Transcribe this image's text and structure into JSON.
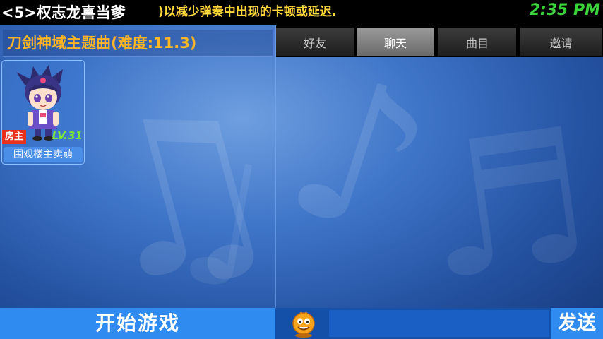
{
  "top_bar": {
    "room_title": "<5>权志龙喜当爹",
    "marquee": ")以减少弹奏中出现的卡顿或延迟.",
    "clock": "2:35 PM"
  },
  "song": {
    "title": "刀剑神域主题曲(难度:11.3)"
  },
  "player": {
    "role_badge": "房主",
    "level": "LV.31",
    "name": "围观楼主卖萌",
    "avatar_icon": "chibi-character-avatar"
  },
  "tabs": [
    {
      "label": "好友",
      "active": false
    },
    {
      "label": "聊天",
      "active": true
    },
    {
      "label": "曲目",
      "active": false
    },
    {
      "label": "邀请",
      "active": false
    }
  ],
  "actions": {
    "start_label": "开始游戏",
    "send_label": "发送",
    "chat_input_value": "",
    "emoji_icon": "smiley-face-icon"
  },
  "colors": {
    "accent": "#2f8bef",
    "song_title": "#ffb526",
    "marquee": "#ffd83a",
    "clock": "#3ad33a",
    "level": "#7ae63a",
    "host_badge": "#e8321f"
  }
}
